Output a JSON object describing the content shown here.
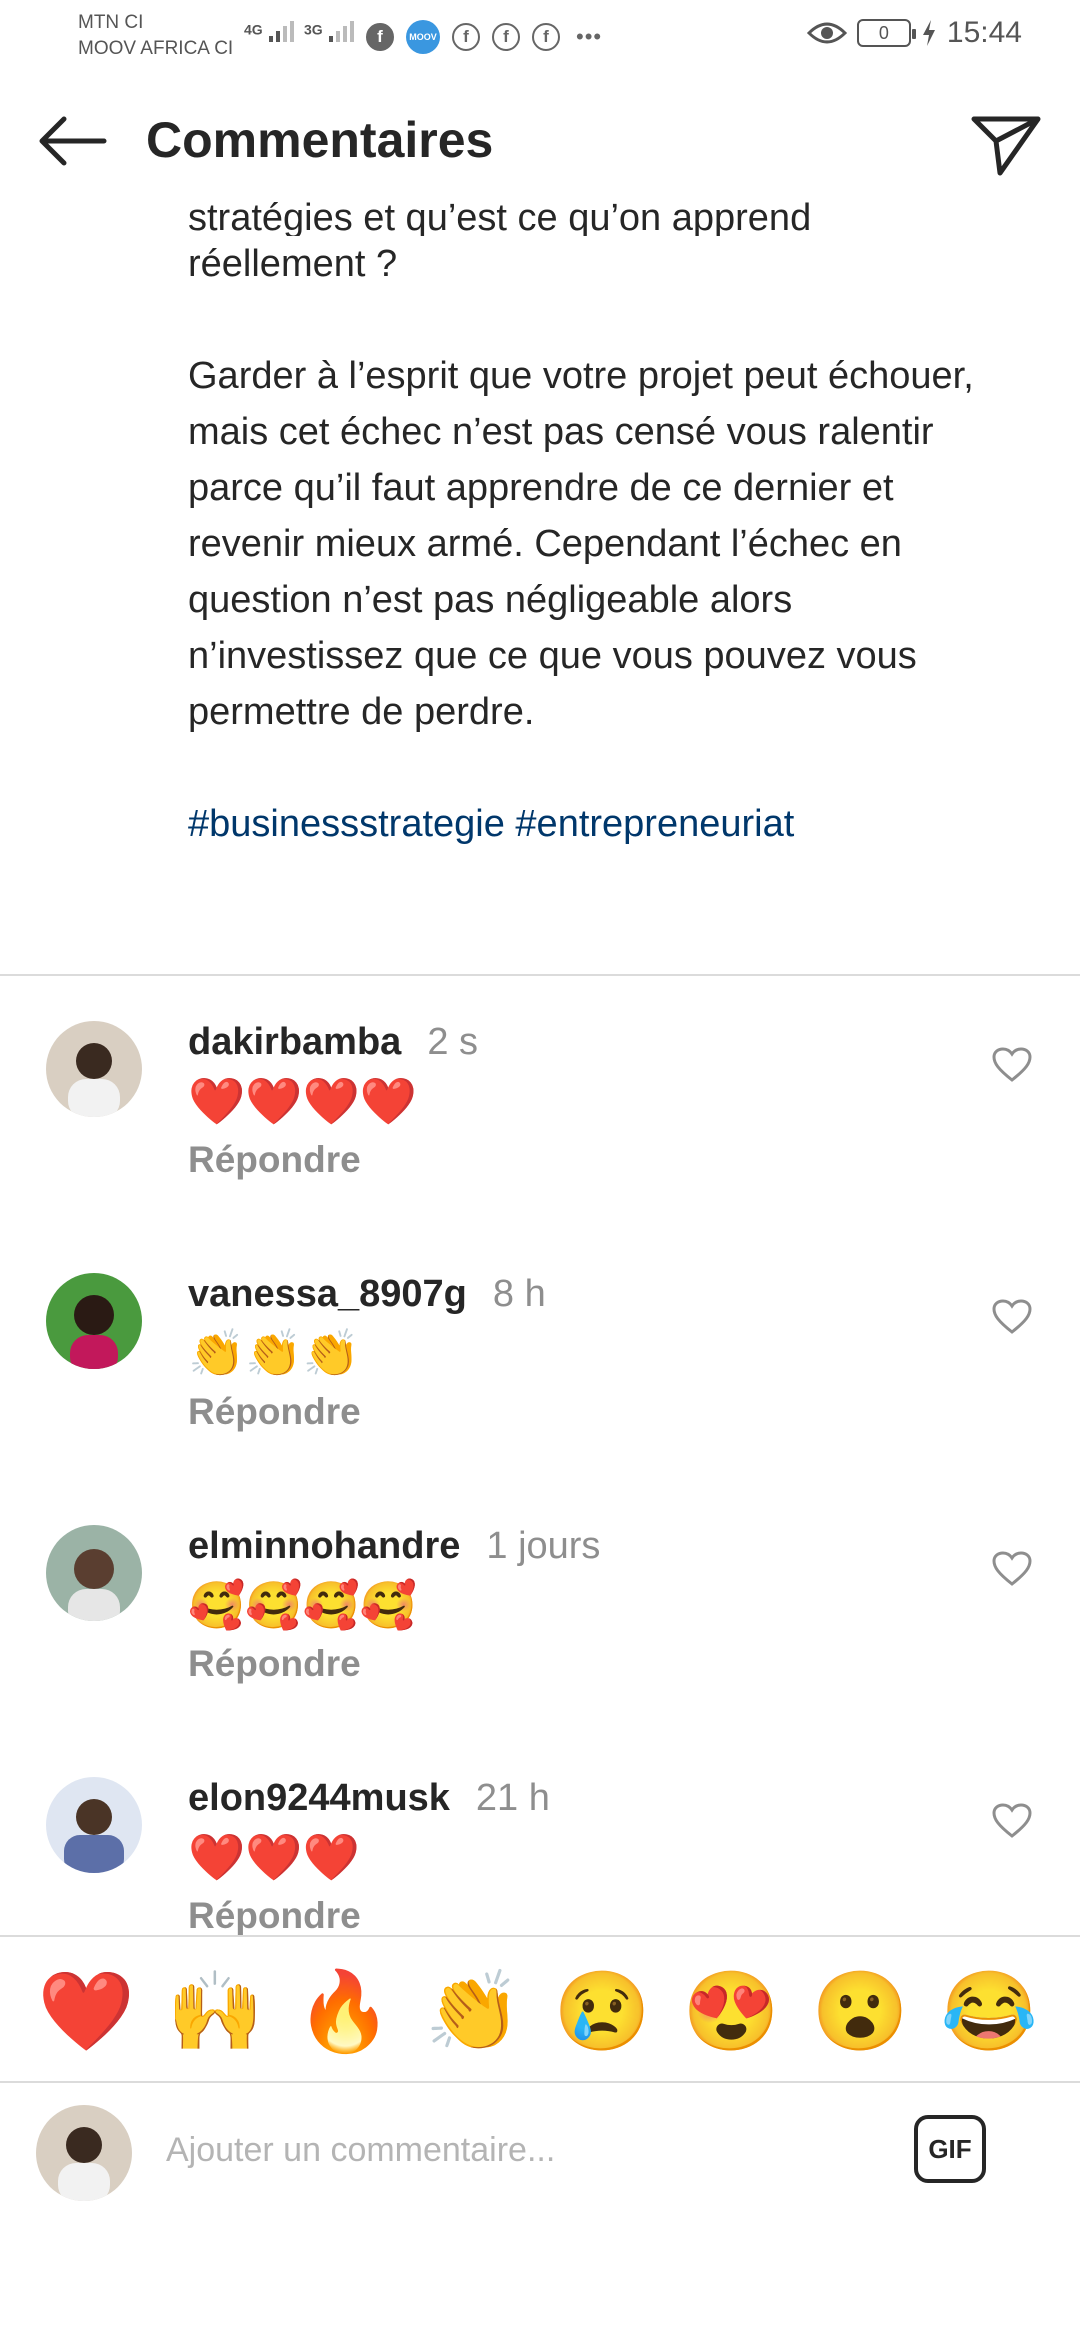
{
  "status_bar": {
    "carrier_1": "MTN CI",
    "carrier_2": "MOOV AFRICA CI",
    "net_1": "4G",
    "net_2": "3G",
    "moov_badge": "MOOV",
    "fb_letter": "f",
    "battery": "0",
    "time": "15:44",
    "icons": [
      "eye-icon",
      "battery-icon",
      "charging-icon",
      "facebook-icon",
      "signal-icon"
    ]
  },
  "header": {
    "title": "Commentaires",
    "back_icon": "arrow-left-icon",
    "share_icon": "paper-plane-icon"
  },
  "caption": {
    "line_top": "stratégies et qu’est ce qu’on apprend",
    "line_top2": "réellement ?",
    "paragraph": "Garder à l’esprit que votre projet peut échouer, mais cet échec n’est pas censé vous ralentir parce qu’il faut apprendre de ce dernier et revenir mieux armé. Cependant l’échec en question n’est pas négligeable alors n’investissez que ce que vous pouvez vous permettre de perdre.",
    "hashtag_1": "#businessstrategie",
    "hashtag_2": "#entrepreneuriat"
  },
  "comments": [
    {
      "username": "dakirbamba",
      "time": "2 s",
      "text": "❤️❤️❤️❤️",
      "reply": "Répondre",
      "avatar_color": "#c9b8a6"
    },
    {
      "username": "vanessa_8907g",
      "time": "8 h",
      "text": "👏👏👏",
      "reply": "Répondre",
      "avatar_color": "#3f8a3a"
    },
    {
      "username": "elminnohandre",
      "time": "1 jours",
      "text": "🥰🥰🥰🥰",
      "reply": "Répondre",
      "avatar_color": "#8fa79b"
    },
    {
      "username": "elon9244musk",
      "time": "21 h",
      "text": "❤️❤️❤️",
      "reply": "Répondre",
      "avatar_color": "#6b7fb0"
    }
  ],
  "reactions": [
    "❤️",
    "🙌",
    "🔥",
    "👏",
    "😢",
    "😍",
    "😮",
    "😂"
  ],
  "composer": {
    "placeholder": "Ajouter un commentaire...",
    "gif_label": "GIF"
  },
  "colors": {
    "text": "#262626",
    "secondary": "#8e8e8e",
    "hashtag": "#00376b",
    "divider": "#dbdbdb",
    "moov": "#3a97e0"
  }
}
